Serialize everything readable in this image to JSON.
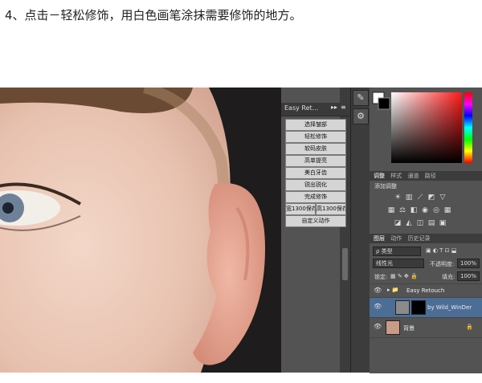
{
  "caption": "4、点击－轻松修饰，用白色画笔涂抹需要修饰的地方。",
  "actions_panel": {
    "title": "Easy Ret...",
    "arrow": "▸▸",
    "menu": "≡",
    "buttons": [
      "选择皱部",
      "轻松修饰",
      "软码皮肤",
      "高单提亮",
      "美白牙齿",
      "锐出锐化",
      "完成修饰",
      "宽1300保存",
      "高1300保存",
      "自定义动作"
    ]
  },
  "panel_tabs_adjust": [
    "调整",
    "样式",
    "通道",
    "路径"
  ],
  "adjust_label": "添加调整",
  "panel_tabs_layers": [
    "图层",
    "动作",
    "历史记录"
  ],
  "layers": {
    "filter_label": "ρ 类型",
    "blend_mode": "线性光",
    "opacity_label": "不透明度:",
    "opacity_value": "100%",
    "lock_label": "锁定:",
    "fill_label": "填充:",
    "fill_value": "100%",
    "group_name": "Easy Retouch",
    "layer_selected": "by Wild_WinDer",
    "layer_bg": "背景"
  },
  "colors": {
    "accent_selected": "#4b6d96",
    "panel_bg": "#535353"
  }
}
